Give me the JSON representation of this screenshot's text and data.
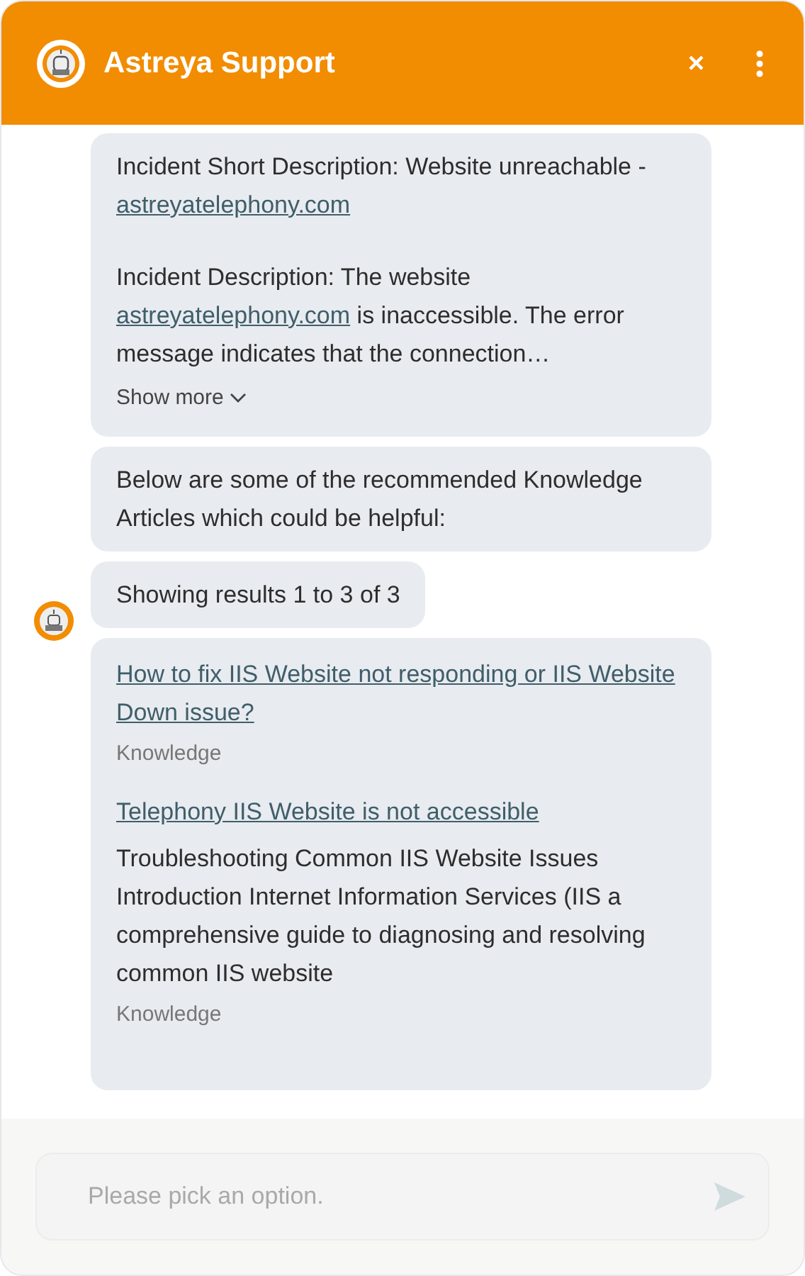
{
  "header": {
    "title": "Astreya Support",
    "close": "×"
  },
  "messages": [
    {
      "kind": "text",
      "paragraphs": [
        [
          {
            "kind": "text",
            "text": "Incident Short Description: Website unreachable - "
          },
          {
            "kind": "link",
            "text": "astreyatelephony.com"
          }
        ],
        [
          {
            "kind": "text",
            "text": "Incident Description: The website "
          },
          {
            "kind": "link",
            "text": "astreyatelephony.com"
          },
          {
            "kind": "text",
            "text": " is inaccessible. The error message indicates that the connection…"
          }
        ]
      ],
      "show_more": "Show more"
    },
    {
      "kind": "text",
      "paragraphs": [
        [
          {
            "kind": "text",
            "text": "Below are some of the recommended Knowledge Articles which could be helpful:"
          }
        ]
      ]
    },
    {
      "kind": "text",
      "paragraphs": [
        [
          {
            "kind": "text",
            "text": "Showing results 1 to 3 of 3"
          }
        ]
      ],
      "avatar": true
    },
    {
      "kind": "results",
      "items": [
        {
          "title": "How to fix IIS Website not responding or IIS Website Down issue?",
          "source": "Knowledge"
        },
        {
          "title": "Telephony IIS Website is not accessible",
          "snippet": "Troubleshooting Common IIS Website Issues Introduction Internet Information Services (IIS a comprehensive guide to diagnosing and resolving common IIS website",
          "source": "Knowledge"
        }
      ]
    }
  ],
  "input": {
    "placeholder": "Please pick an option."
  }
}
